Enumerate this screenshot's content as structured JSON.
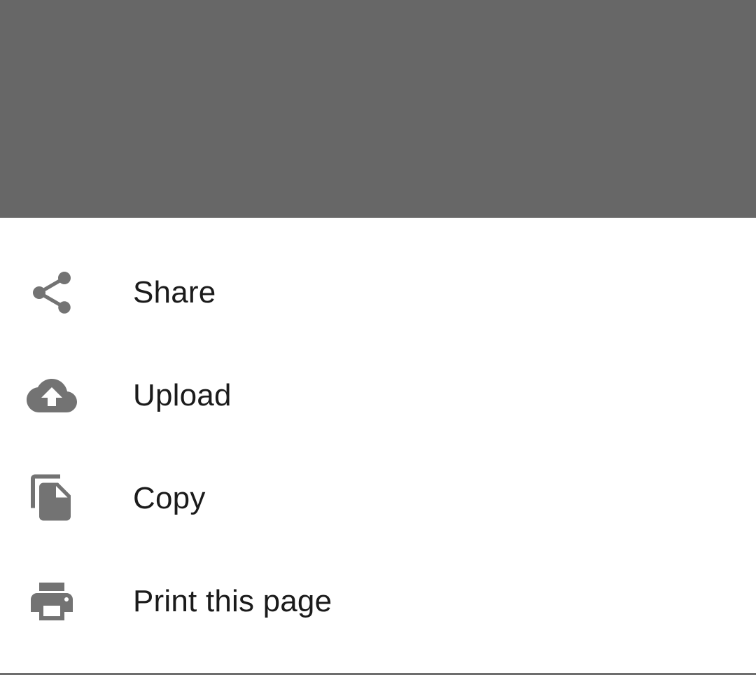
{
  "menu": {
    "items": [
      {
        "id": "share",
        "label": "Share",
        "icon": "share-icon"
      },
      {
        "id": "upload",
        "label": "Upload",
        "icon": "cloud-upload-icon"
      },
      {
        "id": "copy",
        "label": "Copy",
        "icon": "copy-icon"
      },
      {
        "id": "print",
        "label": "Print this page",
        "icon": "print-icon"
      }
    ]
  },
  "colors": {
    "scrim": "#676767",
    "sheet_bg": "#ffffff",
    "icon": "#737373",
    "label_text": "#1b1b1b"
  }
}
